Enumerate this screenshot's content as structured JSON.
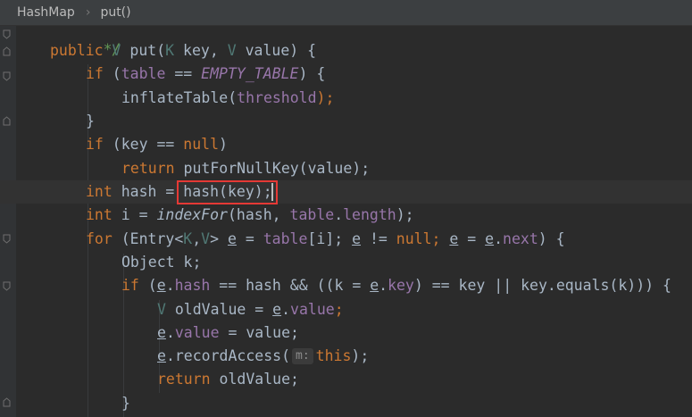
{
  "breadcrumb": {
    "class_name": "HashMap",
    "method_name": "put()"
  },
  "editor": {
    "theme_background": "#2b2b2b",
    "highlight_color": "#e53935",
    "lines": {
      "comment_end": "*/",
      "l1_public": "public",
      "l1_type": "V",
      "l1_method": "put(",
      "l1_k": "K",
      "l1_key": " key, ",
      "l1_v": "V",
      "l1_value": " value) {",
      "l2_if": "if",
      "l2_paren": " (",
      "l2_table": "table",
      "l2_eq": " == ",
      "l2_const": "EMPTY_TABLE",
      "l2_end": ") {",
      "l3_call": "inflateTable(",
      "l3_arg": "threshold",
      "l3_end": ");",
      "l4": "}",
      "l5_if": "if",
      "l5_cond": " (key == ",
      "l5_null": "null",
      "l5_end": ")",
      "l6_return": "return",
      "l6_call": " putForNullKey(value);",
      "l7_int": "int",
      "l7_decl": " hash = ",
      "l7_call": "hash(key);",
      "l8_int": "int",
      "l8_decl": " i = ",
      "l8_static": "indexFor",
      "l8_a": "(hash, ",
      "l8_table": "table",
      "l8_dot": ".",
      "l8_length": "length",
      "l8_end": ");",
      "l9_for": "for",
      "l9_a": " (Entry<",
      "l9_k": "K",
      "l9_comma": ",",
      "l9_v": "V",
      "l9_b": "> ",
      "l9_e1": "e",
      "l9_c": " = ",
      "l9_table": "table",
      "l9_d": "[i]; ",
      "l9_e2": "e",
      "l9_ne": " != ",
      "l9_null": "null",
      "l9_semi": "; ",
      "l9_e3": "e",
      "l9_assign": " = ",
      "l9_e4": "e",
      "l9_dot": ".",
      "l9_next": "next",
      "l9_end": ") {",
      "l10": "Object k;",
      "l11_if": "if",
      "l11_a": " (",
      "l11_e": "e",
      "l11_dot": ".",
      "l11_hash": "hash",
      "l11_b": " == hash && ((k = ",
      "l11_e2": "e",
      "l11_dot2": ".",
      "l11_key": "key",
      "l11_c": ") == key || key.equals(k))) {",
      "l12_v": "V",
      "l12_a": " oldValue = ",
      "l12_e": "e",
      "l12_dot": ".",
      "l12_value": "value",
      "l12_end": ";",
      "l13_e": "e",
      "l13_dot": ".",
      "l13_value": "value",
      "l13_end": " = value;",
      "l14_e": "e",
      "l14_call": ".recordAccess(",
      "l14_hint": "m:",
      "l14_this": "this",
      "l14_end": ");",
      "l15_return": "return",
      "l15_rest": " oldValue;",
      "l16": "}"
    }
  }
}
